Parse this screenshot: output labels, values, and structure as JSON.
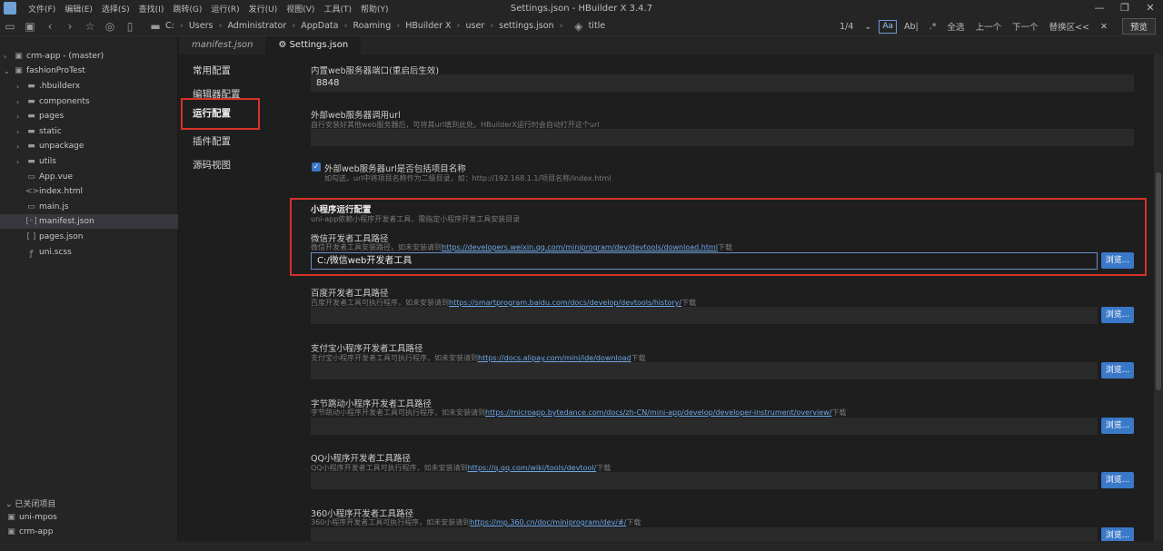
{
  "window": {
    "title": "Settings.json - HBuilder X 3.4.7",
    "menu": [
      "文件(F)",
      "编辑(E)",
      "选择(S)",
      "查找(I)",
      "跳转(G)",
      "运行(R)",
      "发行(U)",
      "视图(V)",
      "工具(T)",
      "帮助(Y)"
    ],
    "controls": [
      "—",
      "❐",
      "✕"
    ]
  },
  "toolbar": {
    "breadcrumb": [
      "C:",
      "Users",
      "Administrator",
      "AppData",
      "Roaming",
      "HBuilder X",
      "user",
      "settings.json"
    ],
    "title_item": "title",
    "find": {
      "count": "1/4",
      "case_label": "Aa",
      "word_label": "Ab|",
      "all": "全选",
      "prev": "上一个",
      "next": "下一个",
      "replace": "替换区<<",
      "close": "✕"
    },
    "preview_label": "预览"
  },
  "sidebar": {
    "projects": [
      {
        "label": "crm-app - (master)",
        "type": "project"
      },
      {
        "label": "fashionProTest",
        "type": "project"
      }
    ],
    "files": [
      {
        "label": ".hbuilderx",
        "type": "folder"
      },
      {
        "label": "components",
        "type": "folder"
      },
      {
        "label": "pages",
        "type": "folder"
      },
      {
        "label": "static",
        "type": "folder"
      },
      {
        "label": "unpackage",
        "type": "folder"
      },
      {
        "label": "utils",
        "type": "folder"
      },
      {
        "label": "App.vue",
        "type": "file"
      },
      {
        "label": "index.html",
        "type": "file"
      },
      {
        "label": "main.js",
        "type": "file"
      },
      {
        "label": "manifest.json",
        "type": "file",
        "selected": true
      },
      {
        "label": "pages.json",
        "type": "file"
      },
      {
        "label": "uni.scss",
        "type": "file"
      }
    ],
    "closed_header": "已关闭项目",
    "closed_projects": [
      "uni-mpos",
      "crm-app"
    ]
  },
  "tabs": [
    {
      "label": "manifest.json",
      "active": false
    },
    {
      "label": "Settings.json",
      "active": true
    }
  ],
  "settings_nav": [
    "常用配置",
    "编辑器配置",
    "运行配置",
    "插件配置",
    "源码视图"
  ],
  "settings": {
    "port": {
      "label": "内置web服务器端口(重启后生效)",
      "value": "8848"
    },
    "external": {
      "label": "外部web服务器调用url",
      "desc": "自行安装好其他web服务器后，可将其url填到此处。HBuilderX运行时会自动打开这个url",
      "value": ""
    },
    "include_name": {
      "label": "外部web服务器url是否包括项目名称",
      "desc": "如勾选，url中将项目名称作为二级目录，如：http://192.168.1.1/项目名称/index.html",
      "checked": true
    },
    "mp_section": {
      "title": "小程序运行配置",
      "desc": "uni-app依赖小程序开发者工具，需指定小程序开发工具安装目录"
    },
    "browse_label": "浏览...",
    "tools": [
      {
        "label": "微信开发者工具路径",
        "desc_prefix": "微信开发者工具安装路径，如未安装请到",
        "link": "https://developers.weixin.qq.com/miniprogram/dev/devtools/download.html",
        "desc_suffix": "下载",
        "value": "C:/微信web开发者工具"
      },
      {
        "label": "百度开发者工具路径",
        "desc_prefix": "百度开发者工具可执行程序，如未安装请到",
        "link": "https://smartprogram.baidu.com/docs/develop/devtools/history/",
        "desc_suffix": "下载",
        "value": ""
      },
      {
        "label": "支付宝小程序开发者工具路径",
        "desc_prefix": "支付宝小程序开发者工具可执行程序，如未安装请到",
        "link": "https://docs.alipay.com/mini/ide/download",
        "desc_suffix": "下载",
        "value": ""
      },
      {
        "label": "字节跳动小程序开发者工具路径",
        "desc_prefix": "字节跳动小程序开发者工具可执行程序，如未安装请到",
        "link": "https://microapp.bytedance.com/docs/zh-CN/mini-app/develop/developer-instrument/overview/",
        "desc_suffix": "下载",
        "value": ""
      },
      {
        "label": "QQ小程序开发者工具路径",
        "desc_prefix": "QQ小程序开发者工具可执行程序，如未安装请到",
        "link": "https://q.qq.com/wiki/tools/devtool/",
        "desc_suffix": "下载",
        "value": ""
      },
      {
        "label": "360小程序开发者工具路径",
        "desc_prefix": "360小程序开发者工具可执行程序，如未安装请到",
        "link": "https://mp.360.cn/doc/miniprogram/dev/#/",
        "desc_suffix": "下载",
        "value": ""
      }
    ]
  },
  "colors": {
    "accent": "#3a78c8",
    "highlight_border": "#d8312a",
    "link": "#6ea8e8"
  }
}
